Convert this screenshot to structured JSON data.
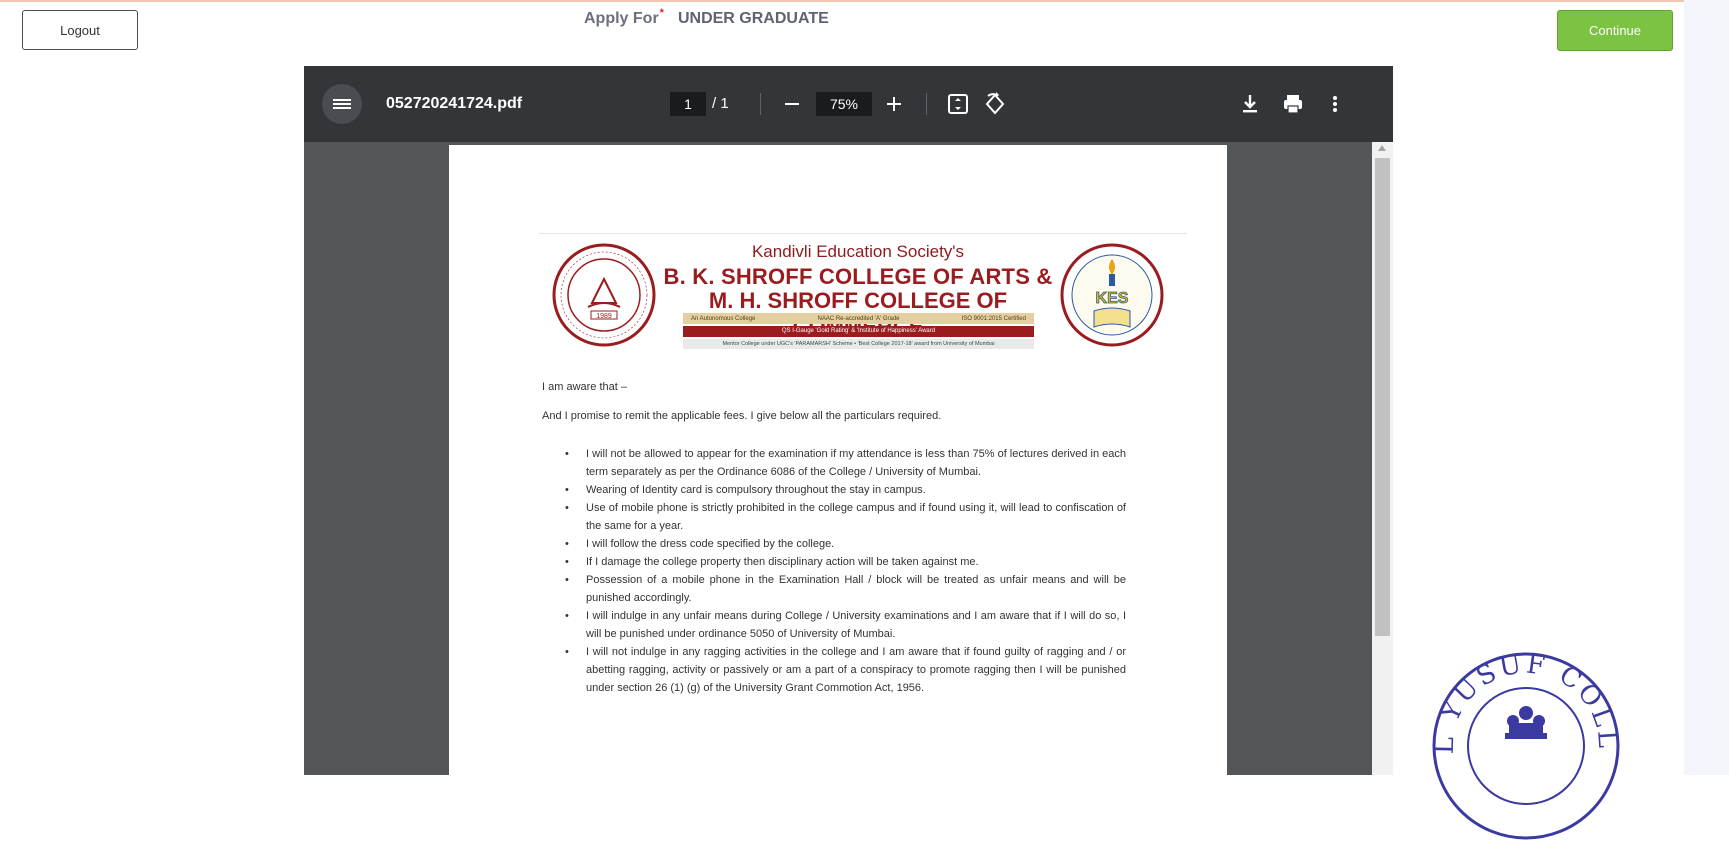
{
  "header": {
    "logout_label": "Logout",
    "apply_label": "Apply For",
    "required_mark": "*",
    "apply_value": "UNDER GRADUATE",
    "continue_label": "Continue"
  },
  "pdf_viewer": {
    "file_name": "052720241724.pdf",
    "current_page": "1",
    "total_pages": "/ 1",
    "zoom": "75%",
    "icons": [
      "menu-icon",
      "zoom-out-icon",
      "zoom-in-icon",
      "fit-page-icon",
      "rotate-icon",
      "download-icon",
      "print-icon",
      "more-options-icon"
    ]
  },
  "document": {
    "society": "Kandivli Education Society's",
    "college_line1": "B. K. SHROFF COLLEGE OF ARTS  &",
    "college_line2": "M. H. SHROFF COLLEGE OF COMMERCE",
    "badge1": "An Autonomous College",
    "badge2": "NAAC Re-accredited 'A' Grade",
    "badge3": "ISO 9001:2015 Certified",
    "award_line": "QS I-Gauge 'Gold Rating' & 'Institute of Happiness' Award",
    "mentor_line": "Mentor College under UGC's 'PARAMARSH' Scheme • 'Best College 2017-18' award from University of Mumbai",
    "left_logo_year": "1989",
    "right_logo_text": "KES",
    "aware_line": "I am aware that –",
    "promise_line": "And I promise to remit the applicable fees. I give below all the particulars required.",
    "rules": [
      "I will not be allowed to appear for the examination if my attendance is less than 75% of lectures derived in each term separately as per the Ordinance 6086 of the College / University of Mumbai.",
      "Wearing of Identity card is compulsory throughout the stay in campus.",
      "Use of mobile phone is strictly prohibited in the college campus and if found using it, will lead to confiscation of the same for a year.",
      "I will follow the dress code specified by the college.",
      "If I damage the college property then disciplinary action will be taken against me.",
      "Possession of a mobile phone in the Examination Hall / block will be treated as unfair means and will be punished accordingly.",
      "I will indulge in any unfair means during College / University examinations and I am aware that if I will do so, I will be punished under ordinance 5050 of University of Mumbai.",
      "I will not indulge in any ragging activities in the college and I am aware that if found guilty of ragging and / or abetting ragging, activity or passively or am a part of a conspiracy to promote ragging then I will be punished under section 26 (1) (g) of the University Grant Commotion Act, 1956."
    ]
  },
  "stamp": {
    "text": "MAIL YUSUF COLLEGE"
  },
  "colors": {
    "continue_green": "#7cc243",
    "viewer_toolbar": "#323639",
    "viewer_bg": "#525659",
    "college_red": "#9b1c1f",
    "stamp_blue": "#3a3aa0"
  }
}
